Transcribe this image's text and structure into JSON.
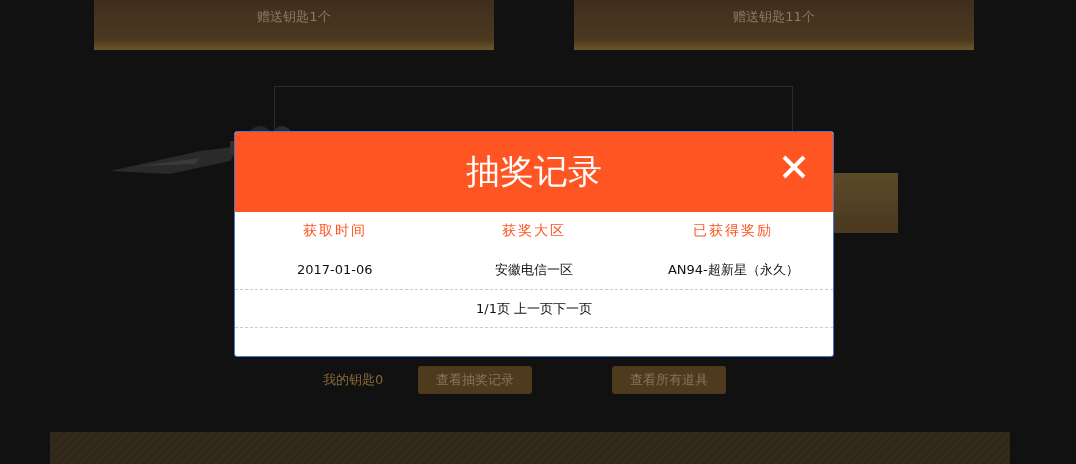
{
  "background": {
    "gift_cards": [
      {
        "label": "赠送钥匙1个"
      },
      {
        "label": "赠送钥匙11个"
      }
    ],
    "my_keys": "我的钥匙0",
    "buttons": [
      "查看抽奖记录",
      "查看所有道具"
    ]
  },
  "dialog": {
    "title": "抽奖记录",
    "columns": [
      "获取时间",
      "获奖大区",
      "已获得奖励"
    ],
    "rows": [
      [
        "2017-01-06",
        "安徽电信一区",
        "AN94-超新星（永久）"
      ]
    ],
    "pagination": {
      "page": "1/1页",
      "links": [
        "上一页",
        "下一页"
      ]
    }
  }
}
